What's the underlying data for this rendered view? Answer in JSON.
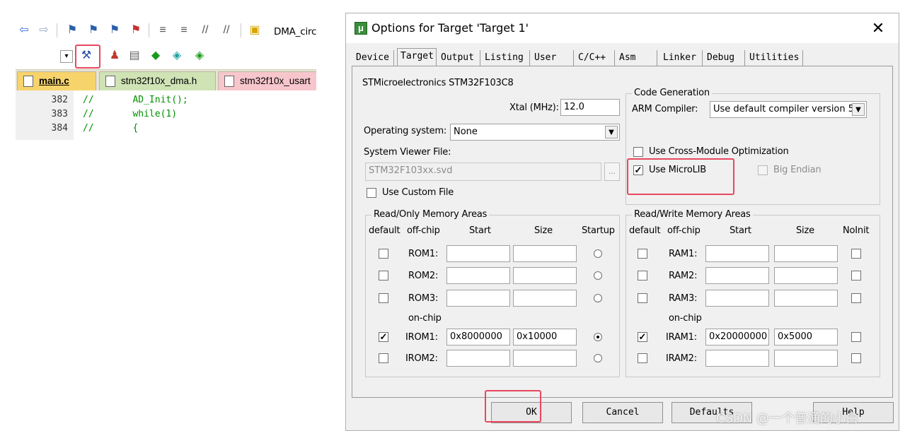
{
  "ide": {
    "toolbar_dma_label": "DMA_circ",
    "tabs": [
      {
        "label": "main.c"
      },
      {
        "label": "stm32f10x_dma.h"
      },
      {
        "label": "stm32f10x_usart"
      }
    ],
    "code_lines": [
      {
        "num": "382",
        "text": "//       AD_Init();"
      },
      {
        "num": "383",
        "text": "//       while(1)"
      },
      {
        "num": "384",
        "text": "//       {"
      }
    ]
  },
  "dialog": {
    "title": "Options for Target 'Target 1'",
    "close_glyph": "✕",
    "tabs": [
      "Device",
      "Target",
      "Output",
      "Listing",
      "User",
      "C/C++",
      "Asm",
      "Linker",
      "Debug",
      "Utilities"
    ],
    "active_tab": "Target",
    "device_name": "STMicroelectronics STM32F103C8",
    "xtal_label": "Xtal (MHz):",
    "xtal_value": "12.0",
    "os_label": "Operating system:",
    "os_value": "None",
    "svf_label": "System Viewer File:",
    "svf_value": "STM32F103xx.svd",
    "browse_label": "...",
    "custom_file_label": "Use Custom File",
    "codegen": {
      "title": "Code Generation",
      "compiler_label": "ARM Compiler:",
      "compiler_value": "Use default compiler version 5",
      "cross_module_label": "Use Cross-Module Optimization",
      "microlib_label": "Use MicroLIB",
      "microlib_checked": true,
      "big_endian_label": "Big Endian"
    },
    "rom": {
      "title": "Read/Only Memory Areas",
      "headers": {
        "default": "default",
        "offchip": "off-chip",
        "start": "Start",
        "size": "Size",
        "startup": "Startup"
      },
      "onchip_label": "on-chip",
      "rows": [
        {
          "name": "ROM1:",
          "start": "",
          "size": "",
          "default": false,
          "startup": false
        },
        {
          "name": "ROM2:",
          "start": "",
          "size": "",
          "default": false,
          "startup": false
        },
        {
          "name": "ROM3:",
          "start": "",
          "size": "",
          "default": false,
          "startup": false
        },
        {
          "name": "IROM1:",
          "start": "0x8000000",
          "size": "0x10000",
          "default": true,
          "startup": true
        },
        {
          "name": "IROM2:",
          "start": "",
          "size": "",
          "default": false,
          "startup": false
        }
      ]
    },
    "ram": {
      "title": "Read/Write Memory Areas",
      "headers": {
        "default": "default",
        "offchip": "off-chip",
        "start": "Start",
        "size": "Size",
        "noinit": "NoInit"
      },
      "onchip_label": "on-chip",
      "rows": [
        {
          "name": "RAM1:",
          "start": "",
          "size": "",
          "default": false,
          "noinit": false
        },
        {
          "name": "RAM2:",
          "start": "",
          "size": "",
          "default": false,
          "noinit": false
        },
        {
          "name": "RAM3:",
          "start": "",
          "size": "",
          "default": false,
          "noinit": false
        },
        {
          "name": "IRAM1:",
          "start": "0x20000000",
          "size": "0x5000",
          "default": true,
          "noinit": false
        },
        {
          "name": "IRAM2:",
          "start": "",
          "size": "",
          "default": false,
          "noinit": false
        }
      ]
    },
    "buttons": {
      "ok": "OK",
      "cancel": "Cancel",
      "defaults": "Defaults",
      "help": "Help"
    }
  },
  "watermark": "CSDN @一个普通的小白",
  "colors": {
    "highlight": "#e8485e",
    "active_tab": "#f6d36b",
    "tab2": "#cfe3b5",
    "tab3": "#f7c6cc"
  }
}
